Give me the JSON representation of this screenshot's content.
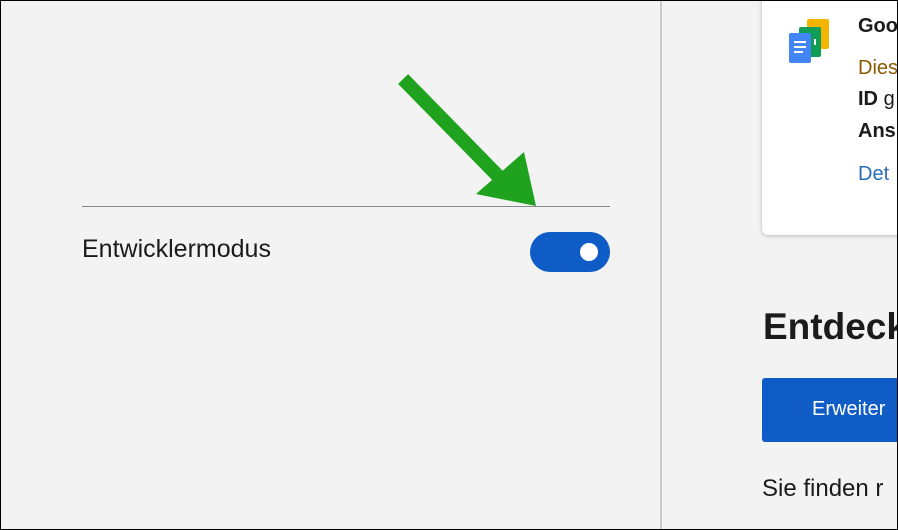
{
  "developer_mode": {
    "label": "Entwicklermodus",
    "enabled": true,
    "toggle_color": "#0f5cc7"
  },
  "annotation": {
    "arrow_color": "#1fa31f",
    "icon": "arrow-down-right-icon"
  },
  "extension_card": {
    "icon": "google-docs-icon",
    "name": "Goo",
    "description": "Dies",
    "id_label": "ID",
    "id_value": "g",
    "view_label": "Ans",
    "details_link": "Det"
  },
  "discover": {
    "title": "Entdeck",
    "button_label": "Erweiter",
    "help_text": "Sie finden r"
  },
  "colors": {
    "background": "#f3f3f3",
    "accent": "#0f5cc7",
    "link": "#2b6cb8",
    "warning_text": "#8b5a00"
  }
}
